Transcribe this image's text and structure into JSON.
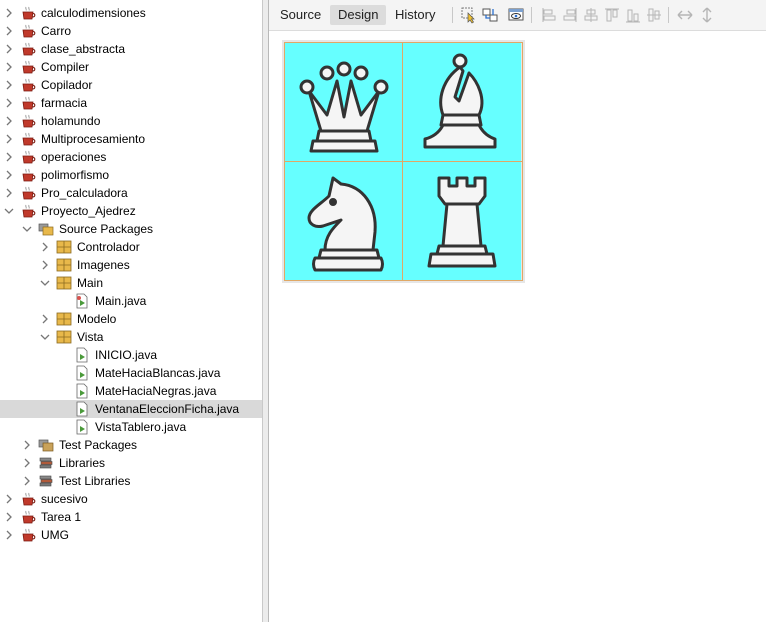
{
  "project_tree": {
    "projects": [
      {
        "label": "calculodimensiones",
        "expanded": false
      },
      {
        "label": "Carro",
        "expanded": false
      },
      {
        "label": "clase_abstracta",
        "expanded": false
      },
      {
        "label": "Compiler",
        "expanded": false
      },
      {
        "label": "Copilador",
        "expanded": false
      },
      {
        "label": "farmacia",
        "expanded": false
      },
      {
        "label": "holamundo",
        "expanded": false
      },
      {
        "label": "Multiprocesamiento",
        "expanded": false
      },
      {
        "label": "operaciones",
        "expanded": false
      },
      {
        "label": "polimorfismo",
        "expanded": false
      },
      {
        "label": "Pro_calculadora",
        "expanded": false
      },
      {
        "label": "Proyecto_Ajedrez",
        "expanded": true
      }
    ],
    "open_project": {
      "source_packages": {
        "label": "Source Packages",
        "packages": [
          {
            "label": "Controlador",
            "expanded": false
          },
          {
            "label": "Imagenes",
            "expanded": false
          },
          {
            "label": "Main",
            "expanded": true,
            "files": [
              "Main.java"
            ]
          },
          {
            "label": "Modelo",
            "expanded": false
          },
          {
            "label": "Vista",
            "expanded": true,
            "files": [
              "INICIO.java",
              "MateHaciaBlancas.java",
              "MateHaciaNegras.java",
              "VentanaEleccionFicha.java",
              "VistaTablero.java"
            ]
          }
        ]
      },
      "other_nodes": [
        "Test Packages",
        "Libraries",
        "Test Libraries"
      ]
    },
    "projects_after": [
      "sucesivo",
      "Tarea 1",
      "UMG"
    ],
    "selected_file": "VentanaEleccionFicha.java"
  },
  "editor": {
    "tabs": [
      {
        "label": "Source",
        "active": false
      },
      {
        "label": "Design",
        "active": true
      },
      {
        "label": "History",
        "active": false
      }
    ],
    "toolbar_icons": [
      "selection-mode-icon",
      "connection-mode-icon",
      "preview-design-icon",
      "align-left-icon",
      "align-right-icon",
      "center-horizontally-icon",
      "align-top-icon",
      "align-bottom-icon",
      "center-vertically-icon",
      "same-width-icon",
      "same-height-icon"
    ],
    "design_form": {
      "pieces": [
        "queen",
        "bishop",
        "knight",
        "rook"
      ],
      "square_color": "#66ffff",
      "border_color": "#e0a866"
    }
  },
  "colors": {
    "selection": "#d9d9d9",
    "package_icon": "#e8b84a",
    "java_file_icon": "#4a9a3a",
    "project_icon": "#c0392b"
  }
}
